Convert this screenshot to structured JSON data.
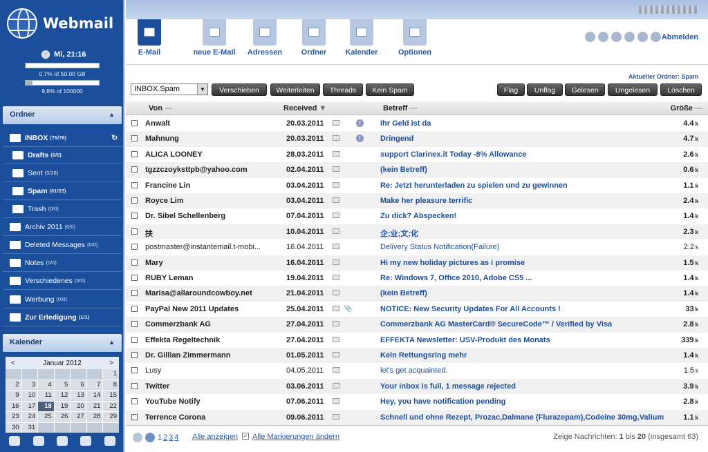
{
  "app": {
    "title": "Webmail"
  },
  "clock": "Mi, 21:16",
  "quota": [
    {
      "label": "0.7% of 50.00 GB",
      "fraction": 0.007
    },
    {
      "label": "9.8% of 100000",
      "fraction": 0.098
    }
  ],
  "sections": {
    "folders": "Ordner",
    "calendar": "Kalender"
  },
  "folders": [
    {
      "name": "INBOX",
      "count": "(76/76)",
      "bold": true
    },
    {
      "name": "Drafts",
      "count": "(6/6)",
      "bold": true
    },
    {
      "name": "Sent",
      "count": "(0/28)",
      "bold": false
    },
    {
      "name": "Spam",
      "count": "(61/63)",
      "bold": true
    },
    {
      "name": "Trash",
      "count": "(0/0)",
      "bold": false
    },
    {
      "name": "Archiv 2011",
      "count": "(0/0)",
      "bold": false
    },
    {
      "name": "Deleted Messages",
      "count": "(0/0)",
      "bold": false
    },
    {
      "name": "Notes",
      "count": "(0/0)",
      "bold": false
    },
    {
      "name": "Verschiedenes",
      "count": "(0/0)",
      "bold": false
    },
    {
      "name": "Werbung",
      "count": "(0/0)",
      "bold": false
    },
    {
      "name": "Zur Erledigung",
      "count": "(1/1)",
      "bold": true
    }
  ],
  "calendar": {
    "month": "Januar 2012",
    "prev": "<",
    "next": ">",
    "weeks": [
      [
        "",
        "",
        "",
        "",
        "",
        "",
        "1"
      ],
      [
        "2",
        "3",
        "4",
        "5",
        "6",
        "7",
        "8"
      ],
      [
        "9",
        "10",
        "11",
        "12",
        "13",
        "14",
        "15"
      ],
      [
        "16",
        "17",
        "18",
        "19",
        "20",
        "21",
        "22"
      ],
      [
        "23",
        "24",
        "25",
        "26",
        "27",
        "28",
        "29"
      ],
      [
        "30",
        "31",
        "",
        "",
        "",
        "",
        ""
      ]
    ],
    "today": "18"
  },
  "toolbar": [
    {
      "label": "E-Mail",
      "icon": "mail-icon",
      "active": true
    },
    {
      "label": "neue E-Mail",
      "icon": "compose-icon",
      "active": false
    },
    {
      "label": "Adressen",
      "icon": "addressbook-icon",
      "active": false
    },
    {
      "label": "Ordner",
      "icon": "folder-icon",
      "active": false
    },
    {
      "label": "Kalender",
      "icon": "calendar-icon",
      "active": false
    },
    {
      "label": "Optionen",
      "icon": "tools-icon",
      "active": false
    }
  ],
  "logout": "Abmelden",
  "current_folder": "Aktueller Ordner: Spam",
  "folder_select": "INBOX.Spam",
  "actions_left": [
    "Verschieben",
    "Weiterleiten",
    "Threads",
    "Kein Spam"
  ],
  "actions_right": [
    "Flag",
    "Unflag",
    "Gelesen",
    "Ungelesen",
    "Löschen"
  ],
  "columns": {
    "from": "Von",
    "received": "Received",
    "subject": "Betreff",
    "size": "Größe"
  },
  "messages": [
    {
      "from": "Anwalt",
      "date": "20.03.2011",
      "subject": "Ihr Geld ist da",
      "size": "4.4",
      "unit": "k",
      "read": false,
      "prio": true,
      "attach": false
    },
    {
      "from": "Mahnung",
      "date": "20.03.2011",
      "subject": "Dringend",
      "size": "4.7",
      "unit": "k",
      "read": false,
      "prio": true,
      "attach": false
    },
    {
      "from": "ALICA LOONEY",
      "date": "28.03.2011",
      "subject": "support Clarinex.it Today -8% Allowance",
      "size": "2.6",
      "unit": "k",
      "read": false,
      "prio": false,
      "attach": false
    },
    {
      "from": "tgzzczoyksttpb@yahoo.com",
      "date": "02.04.2011",
      "subject": "(kein Betreff)",
      "size": "0.6",
      "unit": "k",
      "read": false,
      "prio": false,
      "attach": false
    },
    {
      "from": "Francine Lin",
      "date": "03.04.2011",
      "subject": "Re: Jetzt herunterladen zu spielen und zu gewinnen",
      "size": "1.1",
      "unit": "k",
      "read": false,
      "prio": false,
      "attach": false
    },
    {
      "from": "Royce Lim",
      "date": "03.04.2011",
      "subject": "Make her pleasure terrific",
      "size": "2.4",
      "unit": "k",
      "read": false,
      "prio": false,
      "attach": false
    },
    {
      "from": "Dr. Sibel Schellenberg",
      "date": "07.04.2011",
      "subject": "Zu dick? Abspecken!",
      "size": "1.4",
      "unit": "k",
      "read": false,
      "prio": false,
      "attach": false
    },
    {
      "from": "扶",
      "date": "10.04.2011",
      "subject": "企;业;文;化",
      "size": "2.3",
      "unit": "k",
      "read": false,
      "prio": false,
      "attach": false
    },
    {
      "from": "postmaster@instantemail.t-mobi...",
      "date": "16.04.2011",
      "subject": "Delivery Status Notification(Failure)",
      "size": "2.2",
      "unit": "k",
      "read": true,
      "prio": false,
      "attach": false
    },
    {
      "from": "Mary",
      "date": "16.04.2011",
      "subject": "Hi my new holiday pictures as i promise",
      "size": "1.5",
      "unit": "k",
      "read": false,
      "prio": false,
      "attach": false
    },
    {
      "from": "RUBY Leman",
      "date": "19.04.2011",
      "subject": "Re: Windows 7, Office 2010, Adobe CS5 ...",
      "size": "1.4",
      "unit": "k",
      "read": false,
      "prio": false,
      "attach": false
    },
    {
      "from": "Marisa@allaroundcowboy.net",
      "date": "21.04.2011",
      "subject": "(kein Betreff)",
      "size": "1.4",
      "unit": "k",
      "read": false,
      "prio": false,
      "attach": false
    },
    {
      "from": "PayPal New 2011 Updates",
      "date": "25.04.2011",
      "subject": "NOTICE: New Security Updates For All Accounts !",
      "size": "33",
      "unit": "k",
      "read": false,
      "prio": false,
      "attach": true
    },
    {
      "from": "Commerzbank AG",
      "date": "27.04.2011",
      "subject": "Commerzbank AG MasterCard® SecureCode™ / Verified by Visa",
      "size": "2.8",
      "unit": "k",
      "read": false,
      "prio": false,
      "attach": false
    },
    {
      "from": "Effekta Regeltechnik",
      "date": "27.04.2011",
      "subject": "EFFEKTA Newsletter: USV-Produkt des Monats",
      "size": "339",
      "unit": "k",
      "read": false,
      "prio": false,
      "attach": false
    },
    {
      "from": "Dr. Gillian Zimmermann",
      "date": "01.05.2011",
      "subject": "Kein Rettungsring mehr",
      "size": "1.4",
      "unit": "k",
      "read": false,
      "prio": false,
      "attach": false
    },
    {
      "from": "Lusy",
      "date": "04.05.2011",
      "subject": "let's get acquainted.",
      "size": "1.5",
      "unit": "k",
      "read": true,
      "prio": false,
      "attach": false
    },
    {
      "from": "Twitter",
      "date": "03.06.2011",
      "subject": "Your inbox is full, 1 message rejected",
      "size": "3.9",
      "unit": "k",
      "read": false,
      "prio": false,
      "attach": false
    },
    {
      "from": "YouTube Notify",
      "date": "07.06.2011",
      "subject": "Hey, you have notification pending",
      "size": "2.8",
      "unit": "k",
      "read": false,
      "prio": false,
      "attach": false
    },
    {
      "from": "Terrence Corona",
      "date": "09.06.2011",
      "subject": "Schnell und ohne Rezept, Prozac,Dalmane (Flurazepam),Codeine 30mg,Valium",
      "size": "1.1",
      "unit": "k",
      "read": false,
      "prio": false,
      "attach": false
    }
  ],
  "footer": {
    "pages": [
      "1",
      "2",
      "3",
      "4"
    ],
    "show_all": "Alle anzeigen",
    "change_marks": "Alle Markierungen ändern",
    "summary_prefix": "Zeige Nachrichten:",
    "range_from": "1",
    "range_to": "20",
    "bis": "bis",
    "total": "(insgesamt 63)"
  }
}
